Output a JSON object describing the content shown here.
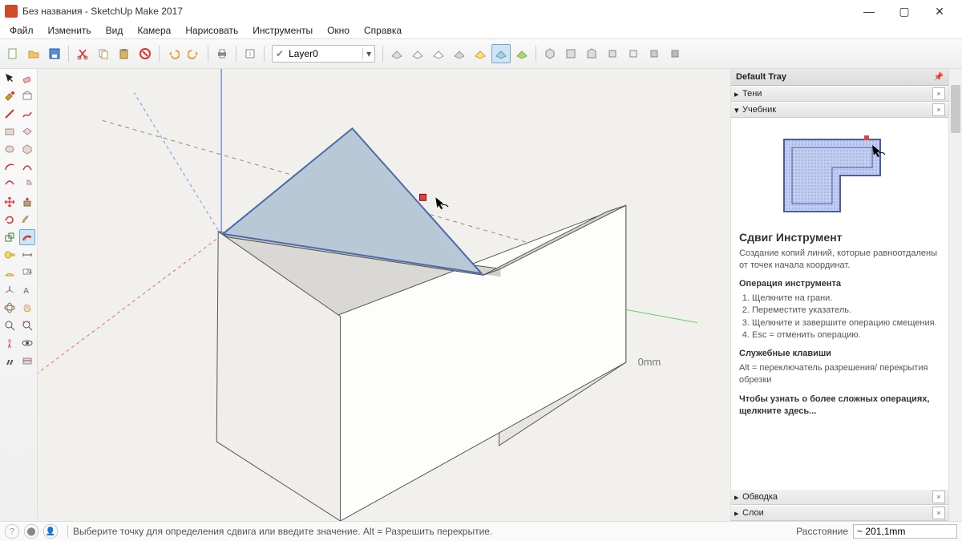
{
  "title": "Без названия - SketchUp Make 2017",
  "menu": [
    "Файл",
    "Изменить",
    "Вид",
    "Камера",
    "Нарисовать",
    "Инструменты",
    "Окно",
    "Справка"
  ],
  "layer": {
    "value": "Layer0"
  },
  "tray": {
    "title": "Default Tray",
    "panels": {
      "shadows": "Тени",
      "instructor": "Учебник",
      "outliner": "Обводка",
      "layers": "Слои"
    }
  },
  "instructor": {
    "tool_title": "Сдвиг Инструмент",
    "tool_desc": "Создание копий линий, которые равноотдалены от точек начала координат.",
    "op_title": "Операция инструмента",
    "steps": [
      "Щелкните на грани.",
      "Переместите указатель.",
      "Щелкните и завершите операцию смещения.",
      "Esc = отменить операцию."
    ],
    "mod_title": "Служебные клавиши",
    "mod_text": "Alt = переключатель разрешения/ перекрытия обрезки",
    "more": "Чтобы узнать о более сложных операциях, щелкните здесь..."
  },
  "dim_label": "0mm",
  "status": {
    "hint": "Выберите точку для определения сдвига или введите значение. Alt = Разрешить перекрытие.",
    "meas_label": "Расстояние",
    "meas_value": "~ 201,1mm"
  }
}
